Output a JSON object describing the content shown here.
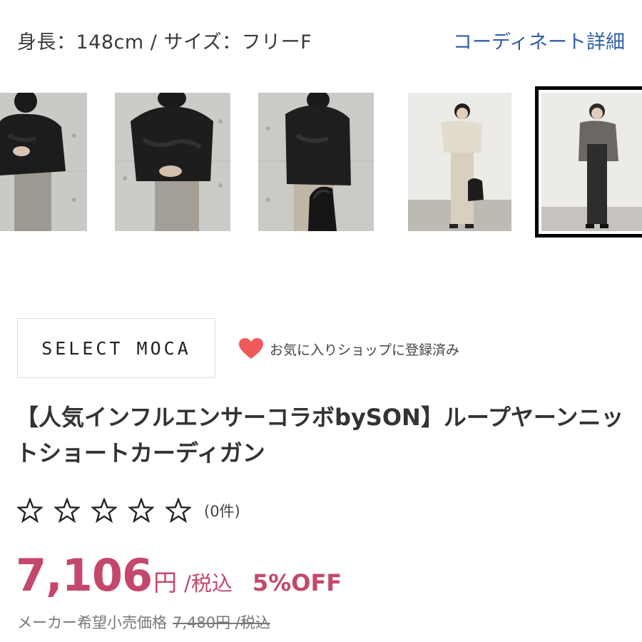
{
  "model_info": {
    "size_text": "身長：148cm / サイズ：フリーF",
    "coordinate_link": "コーディネート詳細"
  },
  "thumbnails": [
    {
      "label": "black-cardigan-photo-1",
      "selected": false
    },
    {
      "label": "black-cardigan-photo-2",
      "selected": false
    },
    {
      "label": "black-cardigan-photo-3",
      "selected": false
    },
    {
      "label": "beige-cardigan-photo",
      "selected": false
    },
    {
      "label": "gray-cardigan-photo",
      "selected": true
    }
  ],
  "shop": {
    "name": "SELECT MOCA",
    "favorite_label": "お気に入りショップに登録済み",
    "favorite_icon": "heart-icon",
    "favorite_color": "#f05a5a"
  },
  "product": {
    "title": "【人気インフルエンサーコラボbySON】ループヤーンニットショートカーディガン",
    "rating_count": "(0件)",
    "stars": 0,
    "price": "7,106",
    "currency": "円",
    "tax_label": "/税込",
    "discount": "5%OFF",
    "msrp_label": "メーカー希望小売価格",
    "msrp_value": "7,480円 /税込",
    "price_color": "#c4486b",
    "link_color": "#2f5fa7"
  }
}
